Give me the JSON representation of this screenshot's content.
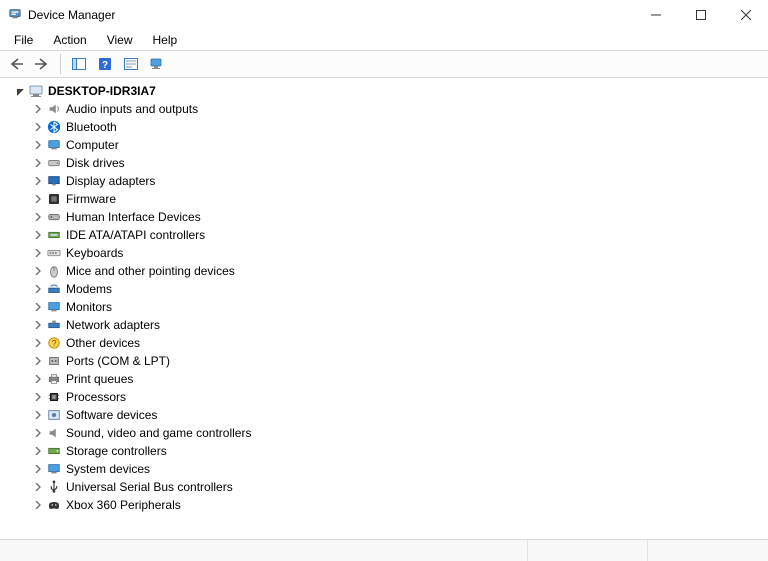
{
  "window": {
    "title": "Device Manager"
  },
  "menubar": {
    "items": [
      {
        "label": "File"
      },
      {
        "label": "Action"
      },
      {
        "label": "View"
      },
      {
        "label": "Help"
      }
    ]
  },
  "tree": {
    "root": {
      "label": "DESKTOP-IDR3IA7",
      "expanded": true
    },
    "children": [
      {
        "label": "Audio inputs and outputs",
        "icon": "audio"
      },
      {
        "label": "Bluetooth",
        "icon": "bluetooth"
      },
      {
        "label": "Computer",
        "icon": "computer"
      },
      {
        "label": "Disk drives",
        "icon": "disk"
      },
      {
        "label": "Display adapters",
        "icon": "display"
      },
      {
        "label": "Firmware",
        "icon": "firmware"
      },
      {
        "label": "Human Interface Devices",
        "icon": "hid"
      },
      {
        "label": "IDE ATA/ATAPI controllers",
        "icon": "ide"
      },
      {
        "label": "Keyboards",
        "icon": "keyboard"
      },
      {
        "label": "Mice and other pointing devices",
        "icon": "mouse"
      },
      {
        "label": "Modems",
        "icon": "modem"
      },
      {
        "label": "Monitors",
        "icon": "monitor"
      },
      {
        "label": "Network adapters",
        "icon": "network"
      },
      {
        "label": "Other devices",
        "icon": "other"
      },
      {
        "label": "Ports (COM & LPT)",
        "icon": "ports"
      },
      {
        "label": "Print queues",
        "icon": "printer"
      },
      {
        "label": "Processors",
        "icon": "cpu"
      },
      {
        "label": "Software devices",
        "icon": "software"
      },
      {
        "label": "Sound, video and game controllers",
        "icon": "sound"
      },
      {
        "label": "Storage controllers",
        "icon": "storage"
      },
      {
        "label": "System devices",
        "icon": "system"
      },
      {
        "label": "Universal Serial Bus controllers",
        "icon": "usb"
      },
      {
        "label": "Xbox 360 Peripherals",
        "icon": "xbox"
      }
    ]
  }
}
